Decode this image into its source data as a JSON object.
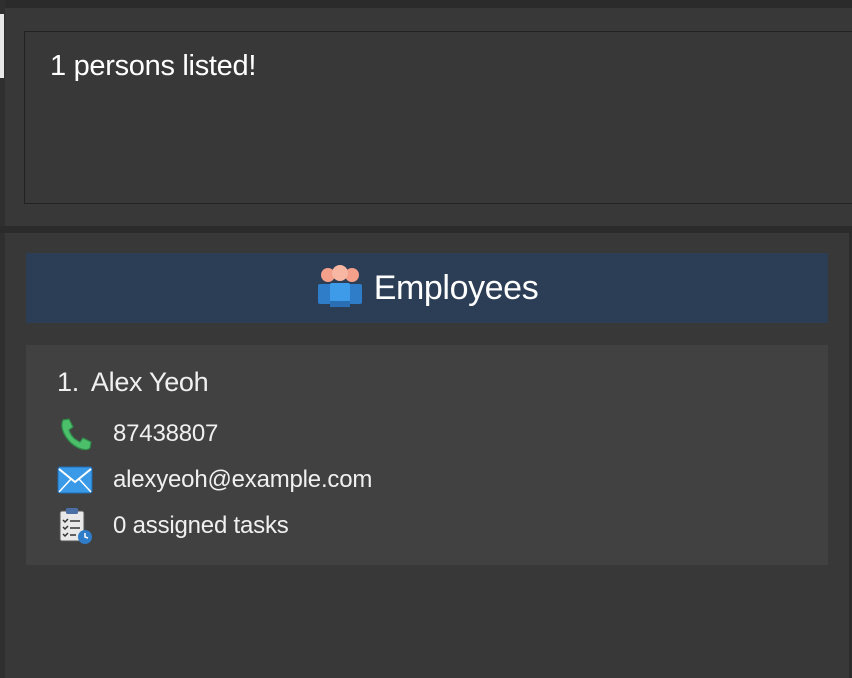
{
  "result": {
    "message": "1 persons listed!"
  },
  "list": {
    "title": "Employees",
    "title_icon": "employees-group-icon",
    "persons": [
      {
        "index": "1.",
        "name": "Alex Yeoh",
        "phone": "87438807",
        "email": "alexyeoh@example.com",
        "tasks": "0 assigned tasks"
      }
    ]
  },
  "colors": {
    "background": "#383838",
    "header_bg": "#2b3e55",
    "card_bg": "#414141",
    "text": "#ffffff"
  }
}
